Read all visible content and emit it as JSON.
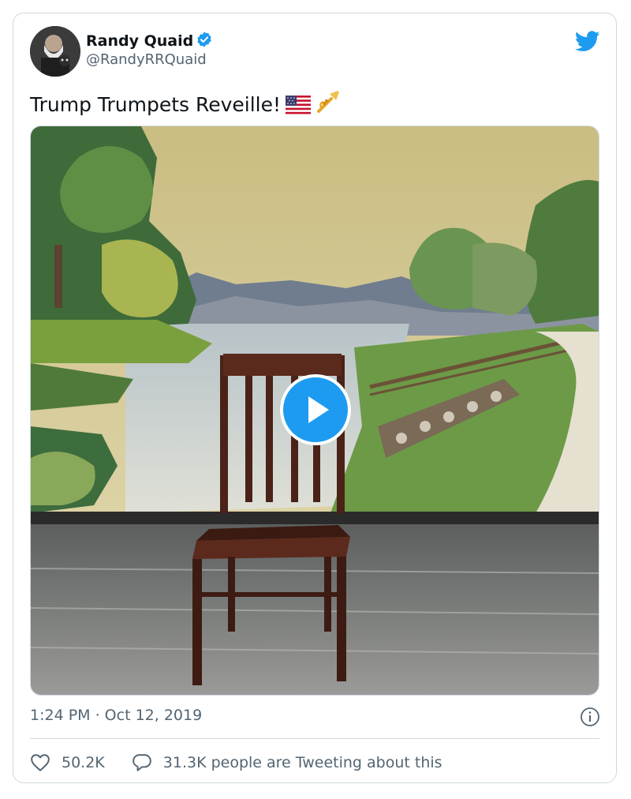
{
  "author": {
    "name": "Randy Quaid",
    "handle": "@RandyRRQuaid",
    "verified": true
  },
  "tweet": {
    "text": "Trump Trumpets Reveille!",
    "emojis": [
      "us-flag-emoji",
      "trumpet-emoji"
    ]
  },
  "media": {
    "type": "video",
    "description_icon": "play-icon"
  },
  "meta": {
    "timestamp": "1:24 PM · Oct 12, 2019"
  },
  "actions": {
    "likes": "50.2K",
    "conversation": "31.3K people are Tweeting about this"
  },
  "colors": {
    "accent": "#1d9bf0",
    "text": "#0f1419",
    "muted": "#536471",
    "border": "#cfd9de"
  }
}
